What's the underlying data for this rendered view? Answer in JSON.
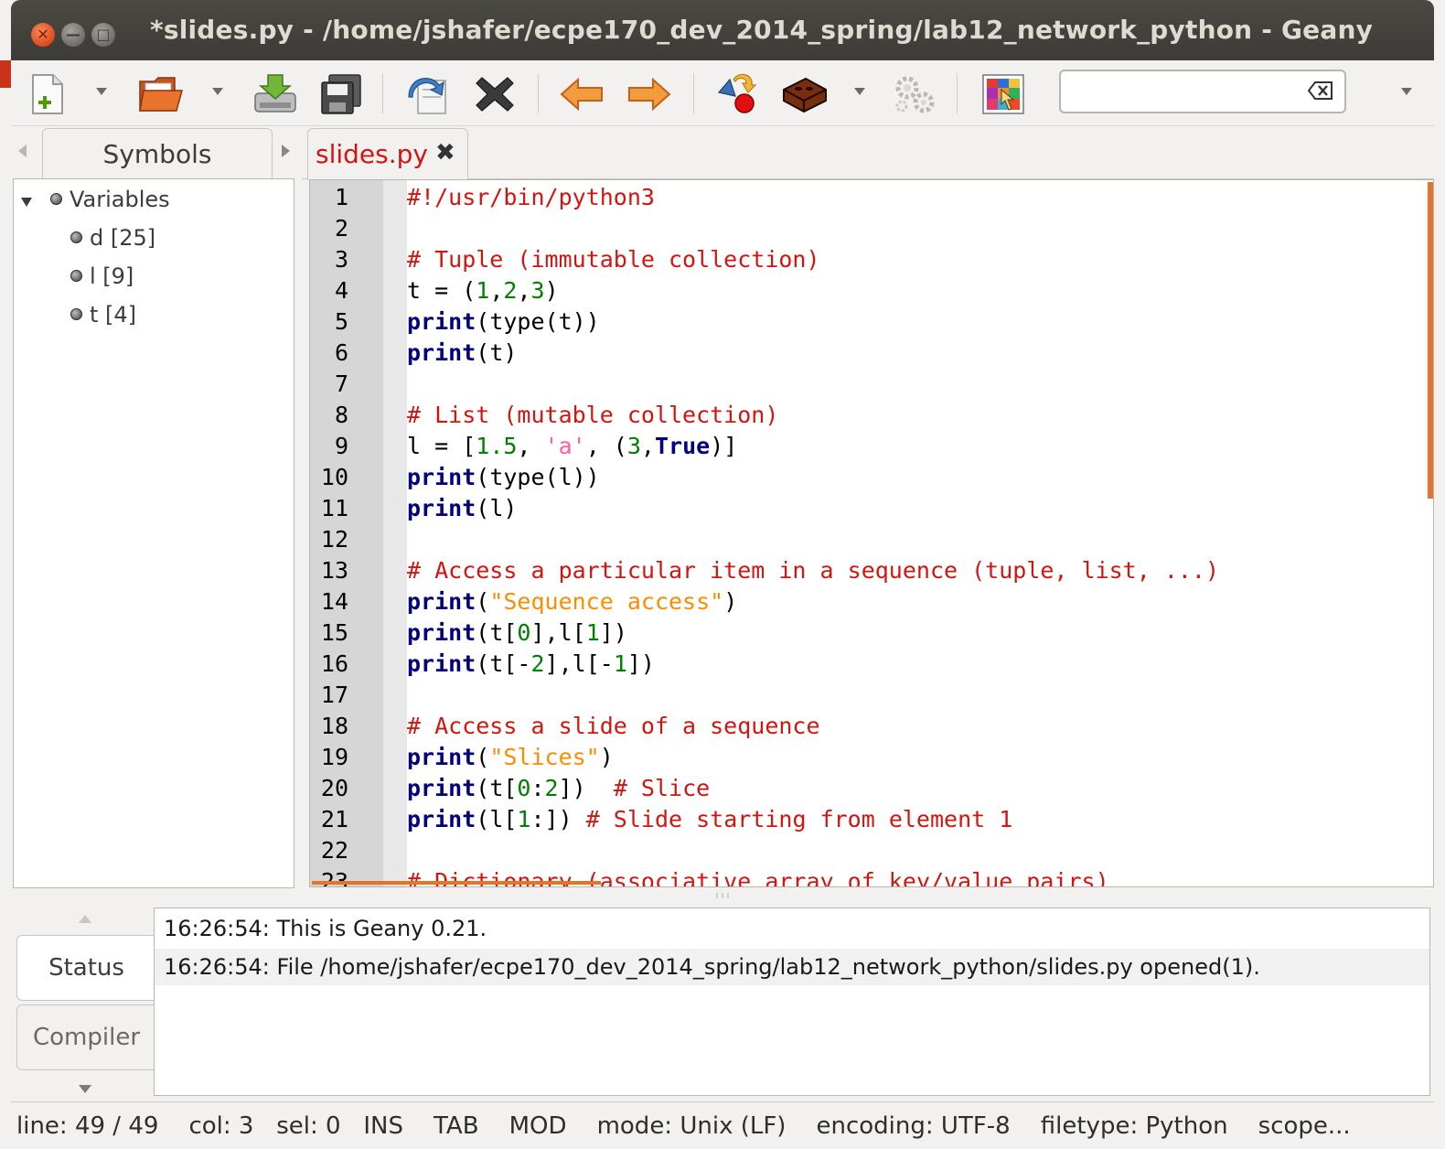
{
  "window": {
    "title": "*slides.py - /home/jshafer/ecpe170_dev_2014_spring/lab12_network_python - Geany",
    "close_glyph": "✕",
    "min_glyph": "—",
    "max_glyph": "□"
  },
  "toolbar": {
    "search_value": "",
    "buttons": [
      "new-file",
      "open-file",
      "save",
      "save-all",
      "revert",
      "close",
      "navigate-back",
      "navigate-forward",
      "compile",
      "build",
      "execute",
      "color-chooser"
    ]
  },
  "sidebar": {
    "tab_label": "Symbols",
    "group_label": "Variables",
    "items": [
      {
        "label": "d [25]"
      },
      {
        "label": "l [9]"
      },
      {
        "label": "t [4]"
      }
    ]
  },
  "editor": {
    "tab_label": "slides.py",
    "close_glyph": "✖",
    "lines": [
      {
        "n": "1",
        "tokens": [
          {
            "t": "#!/usr/bin/python3",
            "c": "com"
          }
        ]
      },
      {
        "n": "2",
        "tokens": []
      },
      {
        "n": "3",
        "tokens": [
          {
            "t": "# Tuple (immutable collection)",
            "c": "com"
          }
        ]
      },
      {
        "n": "4",
        "tokens": [
          {
            "t": "t = (",
            "c": "def"
          },
          {
            "t": "1",
            "c": "num"
          },
          {
            "t": ",",
            "c": "def"
          },
          {
            "t": "2",
            "c": "num"
          },
          {
            "t": ",",
            "c": "def"
          },
          {
            "t": "3",
            "c": "num"
          },
          {
            "t": ")",
            "c": "def"
          }
        ]
      },
      {
        "n": "5",
        "tokens": [
          {
            "t": "print",
            "c": "kw"
          },
          {
            "t": "(type(t))",
            "c": "def"
          }
        ]
      },
      {
        "n": "6",
        "tokens": [
          {
            "t": "print",
            "c": "kw"
          },
          {
            "t": "(t)",
            "c": "def"
          }
        ]
      },
      {
        "n": "7",
        "tokens": []
      },
      {
        "n": "8",
        "tokens": [
          {
            "t": "# List (mutable collection)",
            "c": "com"
          }
        ]
      },
      {
        "n": "9",
        "tokens": [
          {
            "t": "l = [",
            "c": "def"
          },
          {
            "t": "1.5",
            "c": "num"
          },
          {
            "t": ", ",
            "c": "def"
          },
          {
            "t": "'a'",
            "c": "str2"
          },
          {
            "t": ", (",
            "c": "def"
          },
          {
            "t": "3",
            "c": "num"
          },
          {
            "t": ",",
            "c": "def"
          },
          {
            "t": "True",
            "c": "kw"
          },
          {
            "t": ")]",
            "c": "def"
          }
        ]
      },
      {
        "n": "10",
        "tokens": [
          {
            "t": "print",
            "c": "kw"
          },
          {
            "t": "(type(l))",
            "c": "def"
          }
        ]
      },
      {
        "n": "11",
        "tokens": [
          {
            "t": "print",
            "c": "kw"
          },
          {
            "t": "(l)",
            "c": "def"
          }
        ]
      },
      {
        "n": "12",
        "tokens": []
      },
      {
        "n": "13",
        "tokens": [
          {
            "t": "# Access a particular item in a sequence (tuple, list, ...)",
            "c": "com"
          }
        ]
      },
      {
        "n": "14",
        "tokens": [
          {
            "t": "print",
            "c": "kw"
          },
          {
            "t": "(",
            "c": "def"
          },
          {
            "t": "\"Sequence access\"",
            "c": "str"
          },
          {
            "t": ")",
            "c": "def"
          }
        ]
      },
      {
        "n": "15",
        "tokens": [
          {
            "t": "print",
            "c": "kw"
          },
          {
            "t": "(t[",
            "c": "def"
          },
          {
            "t": "0",
            "c": "num"
          },
          {
            "t": "],l[",
            "c": "def"
          },
          {
            "t": "1",
            "c": "num"
          },
          {
            "t": "])",
            "c": "def"
          }
        ]
      },
      {
        "n": "16",
        "tokens": [
          {
            "t": "print",
            "c": "kw"
          },
          {
            "t": "(t[-",
            "c": "def"
          },
          {
            "t": "2",
            "c": "num"
          },
          {
            "t": "],l[-",
            "c": "def"
          },
          {
            "t": "1",
            "c": "num"
          },
          {
            "t": "])",
            "c": "def"
          }
        ]
      },
      {
        "n": "17",
        "tokens": []
      },
      {
        "n": "18",
        "tokens": [
          {
            "t": "# Access a slide of a sequence",
            "c": "com"
          }
        ]
      },
      {
        "n": "19",
        "tokens": [
          {
            "t": "print",
            "c": "kw"
          },
          {
            "t": "(",
            "c": "def"
          },
          {
            "t": "\"Slices\"",
            "c": "str"
          },
          {
            "t": ")",
            "c": "def"
          }
        ]
      },
      {
        "n": "20",
        "tokens": [
          {
            "t": "print",
            "c": "kw"
          },
          {
            "t": "(t[",
            "c": "def"
          },
          {
            "t": "0",
            "c": "num"
          },
          {
            "t": ":",
            "c": "def"
          },
          {
            "t": "2",
            "c": "num"
          },
          {
            "t": "])  ",
            "c": "def"
          },
          {
            "t": "# Slice",
            "c": "com"
          }
        ]
      },
      {
        "n": "21",
        "tokens": [
          {
            "t": "print",
            "c": "kw"
          },
          {
            "t": "(l[",
            "c": "def"
          },
          {
            "t": "1",
            "c": "num"
          },
          {
            "t": ":]) ",
            "c": "def"
          },
          {
            "t": "# Slide starting from element 1",
            "c": "com"
          }
        ]
      },
      {
        "n": "22",
        "tokens": []
      },
      {
        "n": "23",
        "tokens": [
          {
            "t": "# Dictionary (associative array of key/value pairs)",
            "c": "com"
          }
        ]
      }
    ]
  },
  "messages": {
    "tabs": [
      "Status",
      "Compiler"
    ],
    "rows": [
      "16:26:54: This is Geany 0.21.",
      "16:26:54: File /home/jshafer/ecpe170_dev_2014_spring/lab12_network_python/slides.py opened(1)."
    ]
  },
  "statusbar": {
    "text": "line: 49 / 49    col: 3   sel: 0   INS    TAB    MOD    mode: Unix (LF)    encoding: UTF-8    filetype: Python    scope..."
  },
  "colors": {
    "comment": "#d4150f",
    "keyword": "#00007f",
    "number": "#007f00",
    "string": "#ff8c00",
    "accent": "#e5732a"
  }
}
